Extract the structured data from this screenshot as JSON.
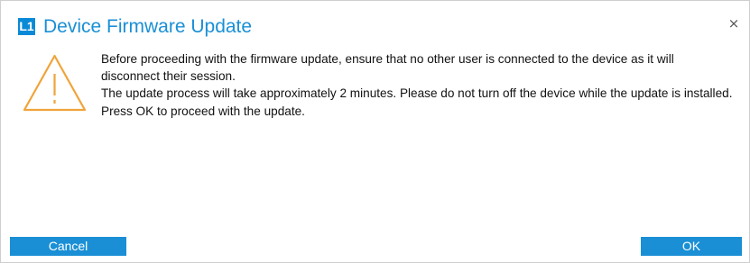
{
  "dialog": {
    "logo_text": "L1",
    "title": "Device Firmware Update",
    "close_glyph": "×",
    "icon": "warning-triangle-icon",
    "message_line1": "Before proceeding with the firmware update, ensure that no other user is connected to the device as it will disconnect their session.",
    "message_line2": "The update process will take approximately 2 minutes. Please do not turn off the device while the update is installed. Press OK to proceed with the update.",
    "cancel_label": "Cancel",
    "ok_label": "OK"
  },
  "colors": {
    "accent": "#1a8fd5",
    "warning": "#f0a43a"
  }
}
